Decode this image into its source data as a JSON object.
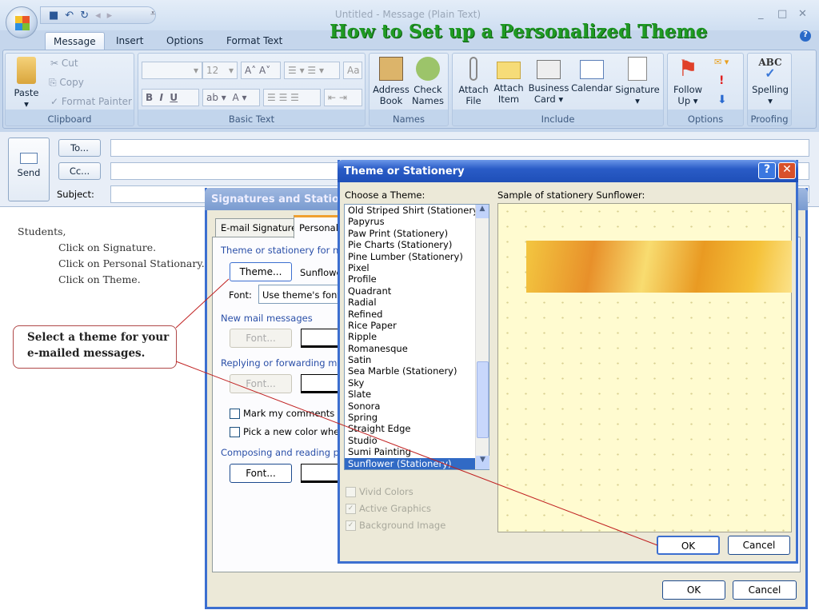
{
  "window": {
    "title": "Untitled - Message (Plain Text)",
    "headline": "How to Set up a Personalized Theme"
  },
  "tabs": [
    "Message",
    "Insert",
    "Options",
    "Format Text"
  ],
  "ribbon": {
    "clipboard": {
      "label": "Clipboard",
      "paste": "Paste",
      "cut": "Cut",
      "copy": "Copy",
      "format_painter": "Format Painter"
    },
    "basic_text": {
      "label": "Basic Text",
      "font_size": "12"
    },
    "names": {
      "label": "Names",
      "address_book": [
        "Address",
        "Book"
      ],
      "check_names": [
        "Check",
        "Names"
      ]
    },
    "include": {
      "label": "Include",
      "attach_file": [
        "Attach",
        "File"
      ],
      "attach_item": [
        "Attach",
        "Item"
      ],
      "business_card": [
        "Business",
        "Card ▾"
      ],
      "calendar": "Calendar",
      "signature": "Signature"
    },
    "options": {
      "label": "Options",
      "follow_up": [
        "Follow",
        "Up ▾"
      ]
    },
    "proofing": {
      "label": "Proofing",
      "spelling": "Spelling"
    }
  },
  "compose": {
    "send": "Send",
    "to": "To...",
    "cc": "Cc...",
    "subject": "Subject:"
  },
  "body_lines": [
    "Students,",
    "Click on Signature.",
    "Click on Personal Stationary.",
    "Click on Theme."
  ],
  "callout": [
    "Select a theme for your",
    "e-mailed messages."
  ],
  "sig_dialog": {
    "title": "Signatures and Stationery",
    "tabs": [
      "E-mail Signature",
      "Personal Stationery"
    ],
    "theme_section": "Theme or stationery for new",
    "theme_button": "Theme...",
    "theme_value": "Sunflower",
    "font_label": "Font:",
    "font_value": "Use theme's font",
    "new_mail": "New mail messages",
    "replying": "Replying or forwarding messa",
    "font_button": "Font...",
    "mark_comments": "Mark my comments with",
    "pick_color": "Pick a new color when r",
    "composing": "Composing and reading plain",
    "ok": "OK",
    "cancel": "Cancel"
  },
  "theme_dialog": {
    "title": "Theme or Stationery",
    "choose_label": "Choose a Theme:",
    "sample_label": "Sample of stationery Sunflower:",
    "themes": [
      "Old Striped Shirt (Stationery)",
      "Papyrus",
      "Paw Print (Stationery)",
      "Pie Charts (Stationery)",
      "Pine Lumber (Stationery)",
      "Pixel",
      "Profile",
      "Quadrant",
      "Radial",
      "Refined",
      "Rice Paper",
      "Ripple",
      "Romanesque",
      "Satin",
      "Sea Marble (Stationery)",
      "Sky",
      "Slate",
      "Sonora",
      "Spring",
      "Straight Edge",
      "Studio",
      "Sumi Painting",
      "Sunflower (Stationery)"
    ],
    "selected": "Sunflower (Stationery)",
    "vivid_colors": "Vivid Colors",
    "active_graphics": "Active Graphics",
    "background_image": "Background Image",
    "vivid_checked": false,
    "active_checked": true,
    "background_checked": true,
    "ok": "OK",
    "cancel": "Cancel"
  },
  "colors": {
    "headline": "#1f9a23",
    "selection": "#316ac5",
    "callout_border": "#b04848",
    "annotation_line": "#c02020"
  }
}
